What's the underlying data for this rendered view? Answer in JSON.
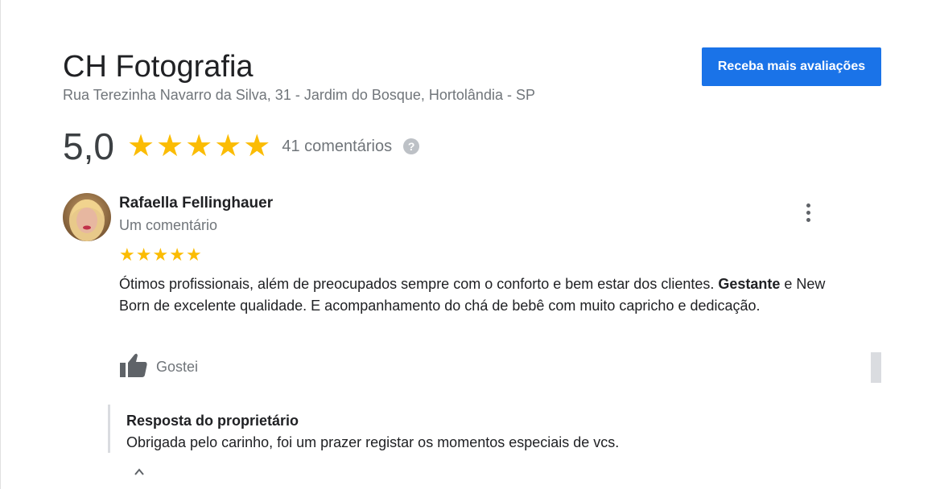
{
  "business": {
    "name": "CH Fotografia",
    "address": "Rua Terezinha Navarro da Silva, 31 - Jardim do Bosque, Hortolândia - SP"
  },
  "cta_button": {
    "label": "Receba mais avaliações",
    "color": "#1a73e8"
  },
  "rating": {
    "score": "5,0",
    "stars": 5,
    "count_text": "41 comentários",
    "star_color": "#fbbc04",
    "help_icon": "help-circle-icon"
  },
  "review": {
    "author": "Rafaella Fellinghauer",
    "subtitle": "Um comentário",
    "stars": 5,
    "text_before_bold": "Ótimos profissionais, além de preocupados sempre com o conforto e bem estar dos clientes. ",
    "text_bold": "Gestante",
    "text_after_bold": " e New Born de excelente qualidade. E acompanhamento do chá de bebê com muito capricho e dedicação.",
    "like_label": "Gostei",
    "like_icon": "thumbs-up-icon",
    "more_icon": "more-vert-icon"
  },
  "owner_reply": {
    "title": "Resposta do proprietário",
    "text": "Obrigada pelo carinho, foi um prazer registar os momentos especiais de vcs."
  }
}
